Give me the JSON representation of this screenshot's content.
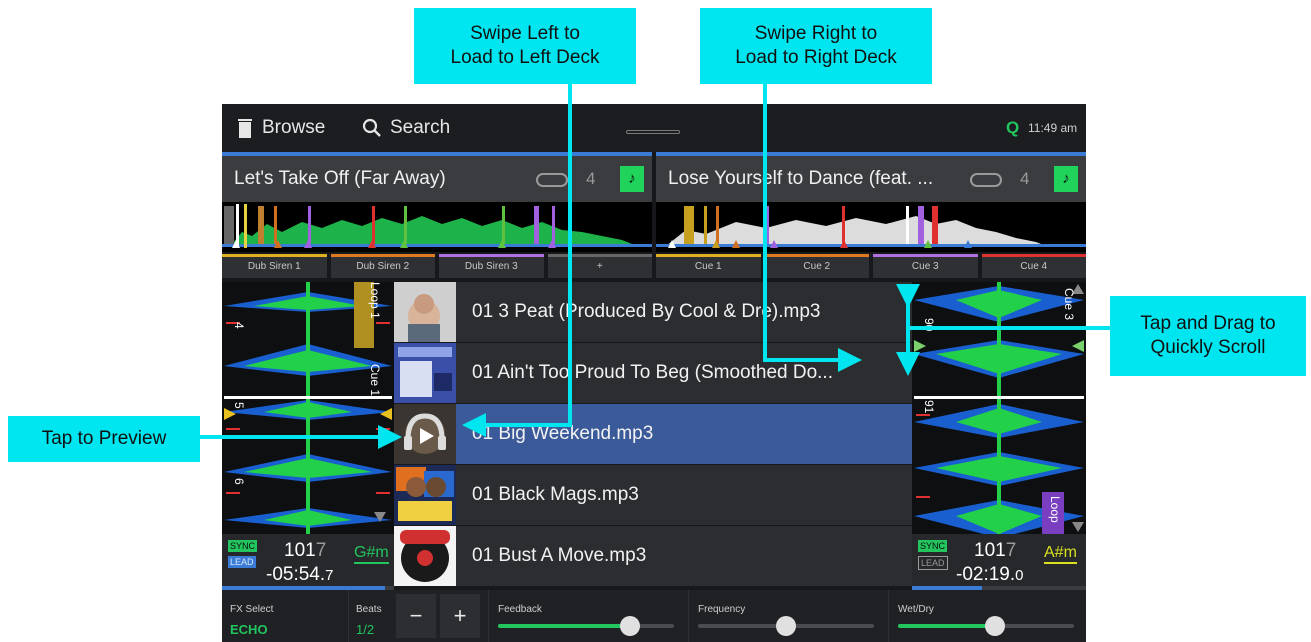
{
  "topbar": {
    "browse_label": "Browse",
    "search_label": "Search",
    "time": "11:49 am",
    "quantize_icon": "Q"
  },
  "decks": {
    "left": {
      "title": "Let's Take Off (Far Away)",
      "loop_number": "4",
      "pads": [
        "Dub Siren 1",
        "Dub Siren 2",
        "Dub Siren 3",
        "+"
      ],
      "pad_colors": [
        "#e0b020",
        "#e07a20",
        "#b070e0",
        "#666666"
      ],
      "markers": {
        "beat_4": "4",
        "beat_5": "5",
        "beat_6": "6",
        "cue_tag": "Cue 1",
        "loop_tag": "Loop 1"
      },
      "sync_label": "SYNC",
      "lead_label": "LEAD",
      "bpm_main": "101",
      "bpm_decimal": "7",
      "key": "G#m",
      "remaining_main": "-05:54.",
      "remaining_decimal": "7",
      "progress": 0.95
    },
    "right": {
      "title": "Lose Yourself to Dance (feat. ...",
      "loop_number": "4",
      "pads": [
        "Cue 1",
        "Cue 2",
        "Cue 3",
        "Cue 4"
      ],
      "pad_colors": [
        "#e0b020",
        "#e07a20",
        "#b070e0",
        "#e03030"
      ],
      "markers": {
        "beat_90": "90",
        "beat_91": "91",
        "cue_tag": "Cue 3",
        "loop_tag": "Loop"
      },
      "sync_label": "SYNC",
      "lead_label": "LEAD",
      "bpm_main": "101",
      "bpm_decimal": "7",
      "key": "A#m",
      "remaining_main": "-02:19.",
      "remaining_decimal": "0",
      "progress": 0.4
    }
  },
  "tracks": [
    {
      "name": "01 3 Peat (Produced By Cool & Dre).mp3",
      "selected": false
    },
    {
      "name": "01 Ain't Too Proud To Beg (Smoothed Do...",
      "selected": false
    },
    {
      "name": "01 Big Weekend.mp3",
      "selected": true
    },
    {
      "name": "01 Black Mags.mp3",
      "selected": false
    },
    {
      "name": "01 Bust A Move.mp3",
      "selected": false
    }
  ],
  "fx": {
    "select_label": "FX Select",
    "select_value": "ECHO",
    "beats_label": "Beats",
    "beats_value": "1/2",
    "minus": "−",
    "plus": "+",
    "feedback_label": "Feedback",
    "feedback_value": 0.75,
    "frequency_label": "Frequency",
    "frequency_value": 0.5,
    "wetdry_label": "Wet/Dry",
    "wetdry_value": 0.55
  },
  "callouts": {
    "swipe_left": "Swipe Left to\nLoad to Left Deck",
    "swipe_right": "Swipe Right to\nLoad to Right Deck",
    "tap_preview": "Tap to Preview",
    "tap_drag": "Tap and Drag to\nQuickly Scroll"
  },
  "colors": {
    "accent_green": "#22c55e",
    "accent_blue": "#3a7bd5",
    "callout_cyan": "#00e6f0"
  }
}
